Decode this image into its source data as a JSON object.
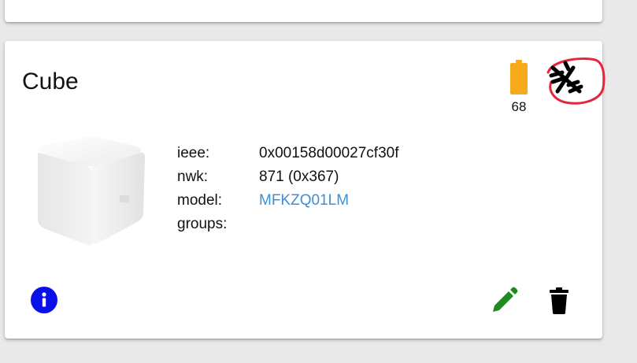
{
  "device": {
    "name": "Cube",
    "battery": 68,
    "battery_label": "68",
    "battery_color": "#f7a91c",
    "link_quality_icon": "signal-off-icon",
    "fields": [
      {
        "key": "ieee:",
        "value": "0x00158d00027cf30f",
        "is_link": false
      },
      {
        "key": "nwk:",
        "value": "871 (0x367)",
        "is_link": false
      },
      {
        "key": "model:",
        "value": "MFKZQ01LM",
        "is_link": true
      },
      {
        "key": "groups:",
        "value": "",
        "is_link": false
      }
    ]
  },
  "actions": {
    "info_icon": "info-icon",
    "edit_icon": "pencil-icon",
    "delete_icon": "trash-icon"
  },
  "colors": {
    "link": "#3b8fd6",
    "info_button": "#0a11e8",
    "edit": "#1f8a1f",
    "annotation_circle": "#e8243b"
  }
}
